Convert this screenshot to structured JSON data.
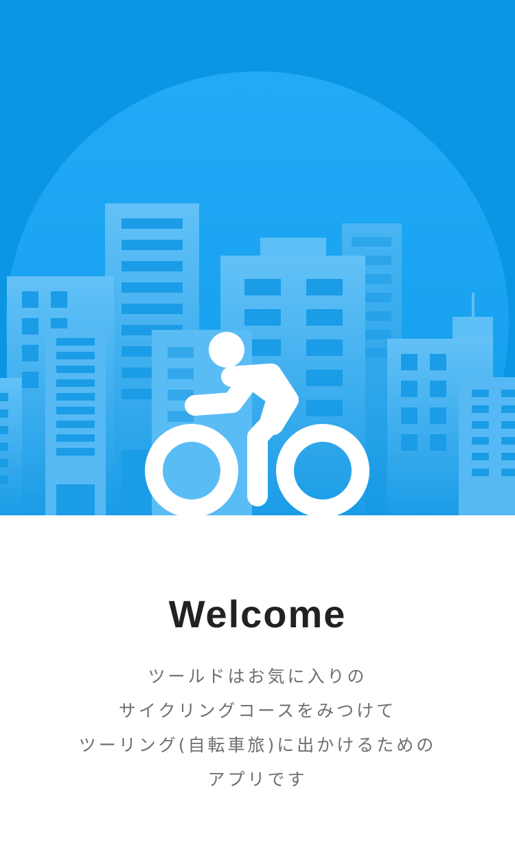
{
  "hero": {
    "illustration": "city-skyline-with-cyclist",
    "icon": "bicycle-rider-icon",
    "colors": {
      "sky": "#0b96e3",
      "sun_top": "#22aaf7",
      "building": "#5bbcf5",
      "rider": "#ffffff"
    }
  },
  "welcome": {
    "title": "Welcome",
    "description_lines": [
      "ツールドはお気に入りの",
      "サイクリングコースをみつけて",
      "ツーリング(自転車旅)に出かけるための",
      "アプリです"
    ]
  }
}
